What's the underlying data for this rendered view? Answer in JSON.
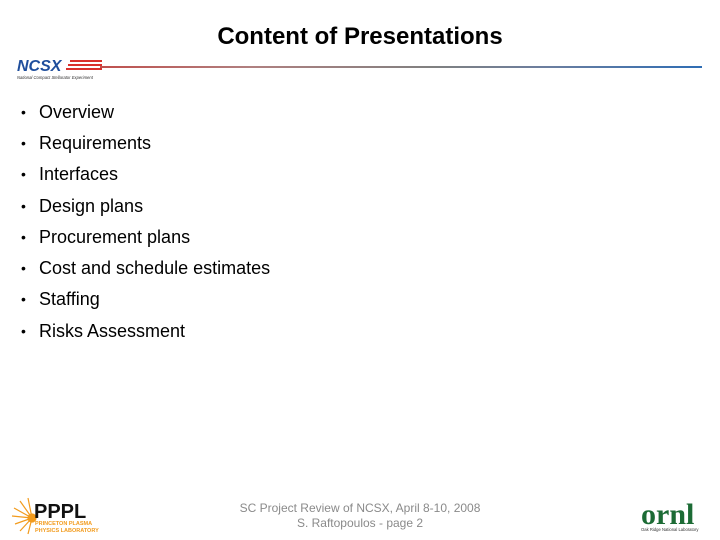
{
  "slide": {
    "title": "Content of Presentations",
    "bullets": [
      "Overview",
      "Requirements",
      "Interfaces",
      "Design plans",
      "Procurement plans",
      "Cost and schedule estimates",
      "Staffing",
      "Risks Assessment"
    ],
    "bullet_glyph": "•"
  },
  "logos": {
    "ncsx": {
      "name": "NCSX",
      "subtitle": "National Compact Stellarator Experiment"
    },
    "pppl": {
      "name": "PPPL",
      "line1": "PRINCETON PLASMA",
      "line2": "PHYSICS LABORATORY"
    },
    "ornl": {
      "name": "ornl",
      "subtitle": "Oak Ridge National Laboratory"
    }
  },
  "footer": {
    "line1": "SC Project Review of NCSX, April 8-10, 2008",
    "line2": "S. Raftopoulos - page 2"
  },
  "colors": {
    "ncsx_blue": "#1f4e9c",
    "ncsx_red": "#d9302b",
    "pppl_orange": "#f29b1d",
    "ornl_green": "#1c6b35",
    "footer_gray": "#8a8a8a"
  }
}
